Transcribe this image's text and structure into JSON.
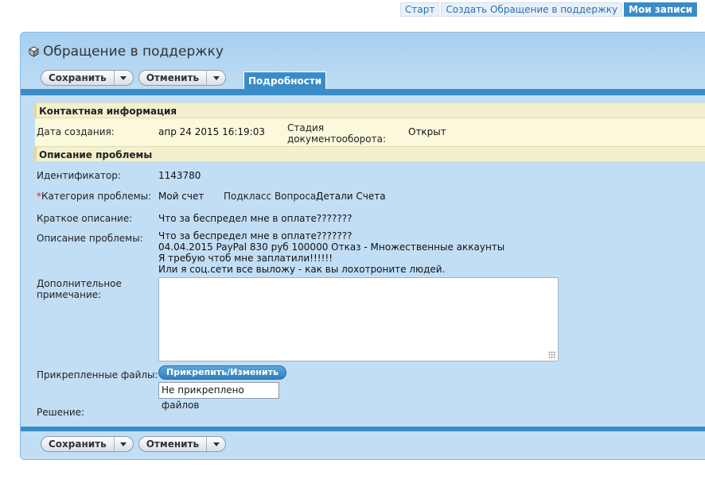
{
  "topnav": {
    "start": "Старт",
    "create": "Создать Обращение в поддержку",
    "records": "Мои записи"
  },
  "page": {
    "title": "Обращение в поддержку"
  },
  "toolbar": {
    "save_label": "Сохранить",
    "cancel_label": "Отменить"
  },
  "tabs": {
    "details": "Подробности"
  },
  "contact": {
    "heading": "Контактная информация",
    "created_label": "Дата создания:",
    "created_value": "апр 24 2015 16:19:03",
    "stage_label_1": "Стадия",
    "stage_label_2": "документооборота:",
    "stage_value": "Открыт"
  },
  "problem": {
    "heading": "Описание проблемы",
    "id_label": "Идентификатор:",
    "id_value": "1143780",
    "required_mark": "*",
    "category_label": "Категория проблемы:",
    "category_value": "Мой счет",
    "subclass_label": "Подкласс Вопроса:",
    "subclass_value": "Детали Счета",
    "short_label": "Краткое описание:",
    "short_value": "Что за беспредел мне в оплате???????",
    "desc_label": "Описание проблемы:",
    "desc_line1": "Что за беспредел мне в оплате???????",
    "desc_line2": "04.04.2015 PayPal 830 руб 100000 Отказ - Множественные аккаунты",
    "desc_line3": "Я требую чтоб мне заплатили!!!!!!",
    "desc_line4": "Или я соц.сети все выложу - как вы лохотроните людей.",
    "note_label_1": "Дополнительное",
    "note_label_2": "примечание:",
    "files_label": "Прикрепленные файлы:",
    "attach_label": "Прикрепить/Изменить",
    "files_value": "Не прикреплено файлов",
    "solution_label": "Решение:"
  }
}
